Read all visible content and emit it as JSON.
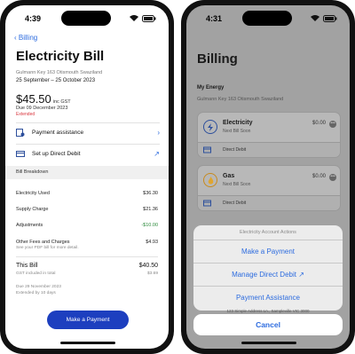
{
  "left": {
    "status_time": "4:39",
    "back_label": "Billing",
    "title": "Electricity Bill",
    "address": "Gulmann Key 163 Otismouth Swaziland",
    "period": "25 September – 25 October 2023",
    "amount": "$45.50",
    "amount_suffix": "inc GST",
    "due": "Due 09 December 2023",
    "extended": "Extended",
    "actions": [
      {
        "label": "Payment assistance",
        "chevron": "›"
      },
      {
        "label": "Set up Direct Debit",
        "chevron": "↗"
      }
    ],
    "breakdown_header": "Bill Breakdown",
    "lines": [
      {
        "label": "Electricity Used",
        "value": "$36.30"
      },
      {
        "label": "Supply Charge",
        "value": "$21.36"
      },
      {
        "label": "Adjustments",
        "value": "-$10.00"
      },
      {
        "label": "Other Fees and Charges",
        "value": "$4.93"
      }
    ],
    "pdf_note": "See your PDF bill for more detail.",
    "this_bill_label": "This Bill",
    "this_bill_value": "$40.50",
    "gst_label": "GST included in total",
    "gst_value": "$3.69",
    "due2": "Due 29 November 2023",
    "ext2": "Extended by 10 days",
    "pay_button": "Make a Payment"
  },
  "right": {
    "status_time": "4:31",
    "title": "Billing",
    "my_energy": "My Energy",
    "address": "Gulmann Key 163 Otismouth Swaziland",
    "cards": [
      {
        "name": "Electricity",
        "next": "Next Bill Soon",
        "amount": "$0.00",
        "foot": "Direct Debit",
        "icon": "lightning-icon"
      },
      {
        "name": "Gas",
        "next": "Next Bill Soon",
        "amount": "$0.00",
        "foot": "Direct Debit",
        "icon": "flame-icon"
      }
    ],
    "sheet_header": "Electricity Account Actions",
    "sheet_actions": [
      "Make a Payment",
      "Manage Direct Debit ↗",
      "Payment Assistance"
    ],
    "behind_text": "123 Simple Address Ln., Sampleville VIC 3000",
    "cancel": "Cancel"
  },
  "colors": {
    "accent": "#2d6cdf",
    "button": "#1d3fbf",
    "negative": "#d9363e",
    "positive": "#2e8b3d"
  }
}
